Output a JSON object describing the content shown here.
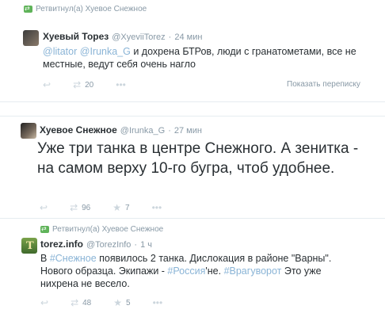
{
  "tweets": [
    {
      "retweet_line": "Ретвитнул(а) Хуевое Снежное",
      "name": "Хуевый Торез",
      "handle": "@XyeviiTorez",
      "time": "24 мин",
      "segments": [
        {
          "text": "@litator",
          "type": "link"
        },
        {
          "text": " ",
          "type": "text"
        },
        {
          "text": "@Irunka_G",
          "type": "link"
        },
        {
          "text": " и дохрена БТРов, люди с гранатометами, все не местные, ведут себя очень нагло",
          "type": "text"
        }
      ],
      "actions": {
        "reply_icon": "reply-icon",
        "retweet_icon": "retweet-icon",
        "retweet_count": "20",
        "more_icon": "more-icon"
      },
      "conversation_link": "Показать переписку"
    },
    {
      "name": "Хуевое Снежное",
      "handle": "@Irunka_G",
      "time": "27 мин",
      "text": "Уже три танка в центре Снежного. А зенитка - на самом верху 10-го бугра, чтоб удобнее.",
      "actions": {
        "reply_icon": "reply-icon",
        "retweet_icon": "retweet-icon",
        "retweet_count": "96",
        "favorite_icon": "star-icon",
        "favorite_count": "7",
        "more_icon": "more-icon"
      }
    },
    {
      "retweet_line": "Ретвитнул(а) Хуевое Снежное",
      "name": "torez.info",
      "handle": "@TorezInfo",
      "time": "1 ч",
      "segments": [
        {
          "text": "В ",
          "type": "text"
        },
        {
          "text": "#Снежное",
          "type": "hash"
        },
        {
          "text": " появилось 2 танка. Дислокация в районе \"Варны\". Нового образца. Экипажи - ",
          "type": "text"
        },
        {
          "text": "#Россия",
          "type": "hash"
        },
        {
          "text": "'не. ",
          "type": "text"
        },
        {
          "text": "#Врагуворот",
          "type": "hash"
        },
        {
          "text": " Это уже нихрена не весело.",
          "type": "text"
        }
      ],
      "actions": {
        "reply_icon": "reply-icon",
        "retweet_icon": "retweet-icon",
        "retweet_count": "48",
        "favorite_icon": "star-icon",
        "favorite_count": "5",
        "more_icon": "more-icon"
      }
    }
  ],
  "separator": "·",
  "colors": {
    "link": "#8ab4d6",
    "retweet_badge": "#5fb359",
    "meta": "#8899a6"
  }
}
